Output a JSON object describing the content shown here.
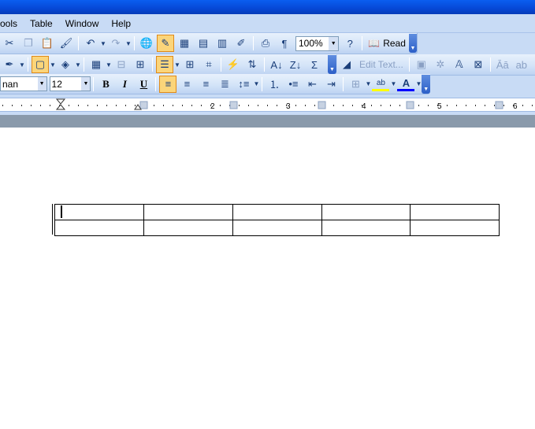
{
  "menubar": {
    "items": [
      "ools",
      "Table",
      "Window",
      "Help"
    ]
  },
  "toolbar_standard": {
    "zoom_value": "100%",
    "read_label": "Read"
  },
  "toolbar_tables": {
    "edit_text_label": "Edit Text..."
  },
  "toolbar_format": {
    "font_name": "nan",
    "font_size": "12",
    "bold": "B",
    "italic": "I",
    "underline": "U",
    "highlight_letters": "ab",
    "font_color_letter": "A"
  },
  "ruler": {
    "numbers": [
      "2",
      "3",
      "4",
      "5",
      "6"
    ]
  },
  "table": {
    "rows": 2,
    "cols": 5
  },
  "colors": {
    "title_blue": "#0648d6",
    "toolbar_blue": "#c8dbf5",
    "active_orange": "#fbd57a"
  }
}
